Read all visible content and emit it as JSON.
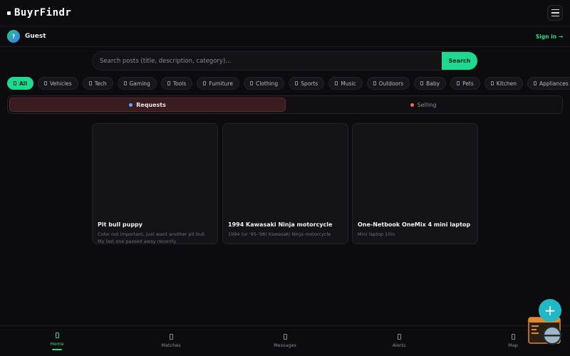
{
  "brand": {
    "name": "BuyrFindr"
  },
  "user": {
    "avatar_initial": "?",
    "name": "Guest",
    "signin_label": "Sign in →"
  },
  "search": {
    "placeholder": "Search posts (title, description, category)...",
    "button_label": "Search"
  },
  "categories": [
    {
      "label": "All",
      "active": true
    },
    {
      "label": "Vehicles"
    },
    {
      "label": "Tech"
    },
    {
      "label": "Gaming"
    },
    {
      "label": "Tools"
    },
    {
      "label": "Furniture"
    },
    {
      "label": "Clothing"
    },
    {
      "label": "Sports"
    },
    {
      "label": "Music"
    },
    {
      "label": "Outdoors"
    },
    {
      "label": "Baby"
    },
    {
      "label": "Pets"
    },
    {
      "label": "Kitchen"
    },
    {
      "label": "Appliances"
    }
  ],
  "toggle": {
    "requests_label": "Requests",
    "selling_label": "Selling",
    "active": "requests"
  },
  "posts": [
    {
      "title": "Pit bull puppy",
      "description": "Color not important, just want another pit bull. My last one passed away recently"
    },
    {
      "title": "1994 Kawasaki Ninja motorcycle",
      "description": "1994 (or '95-'98) Kawasaki Ninja motorcycle"
    },
    {
      "title": "One-Netbook OneMix 4 mini laptop",
      "description": "Mini laptop 10in"
    }
  ],
  "fab": {
    "label": "+"
  },
  "nav": [
    {
      "label": "Home",
      "active": true
    },
    {
      "label": "Matches"
    },
    {
      "label": "Messages"
    },
    {
      "label": "Alerts"
    },
    {
      "label": "Map"
    }
  ],
  "colors": {
    "accent": "#1ed98f",
    "fab": "#1fb8c4",
    "background": "#0c0c0e"
  }
}
